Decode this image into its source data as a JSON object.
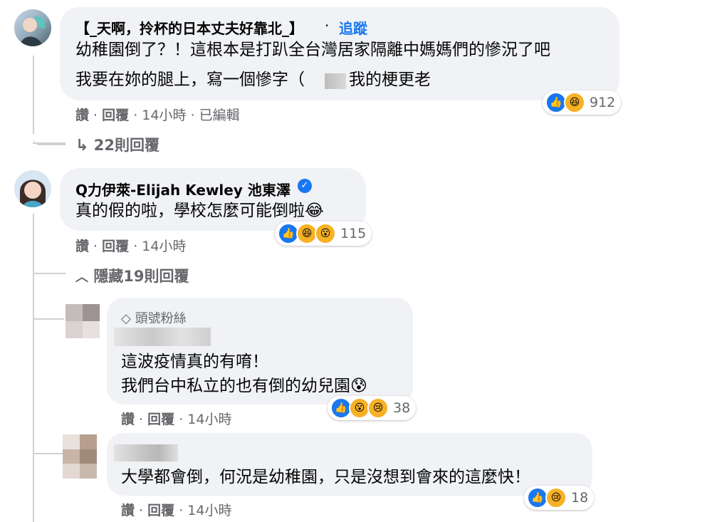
{
  "comments": [
    {
      "author": "【_天啊，拎杯的日本丈夫好靠北_】",
      "follow_label": "追蹤",
      "lines": [
        "幼稚園倒了？！這根本是打趴全台灣居家隔離中媽媽們的慘況了吧",
        "我要在妳的腿上，寫一個慘字（",
        "我的梗更老"
      ],
      "meta": {
        "like": "讚",
        "reply": "回覆",
        "time": "14小時",
        "edited": "已編輯"
      },
      "reactions": {
        "count": "912",
        "icons": [
          "like-icon",
          "haha-icon"
        ]
      },
      "replies_toggle": "22則回覆"
    },
    {
      "author": "Q力伊萊-Elijah Kewley 池東澤",
      "verified": true,
      "lines": [
        "真的假的啦，學校怎麼可能倒啦😂"
      ],
      "meta": {
        "like": "讚",
        "reply": "回覆",
        "time": "14小時"
      },
      "reactions": {
        "count": "115",
        "icons": [
          "like-icon",
          "haha-icon",
          "wow-icon"
        ]
      },
      "replies_toggle": "隱藏19則回覆"
    }
  ],
  "replies": [
    {
      "badge": "頭號粉絲",
      "lines": [
        "這波疫情真的有唷！",
        "我們台中私立的也有倒的幼兒園😰"
      ],
      "meta": {
        "like": "讚",
        "reply": "回覆",
        "time": "14小時"
      },
      "reactions": {
        "count": "38",
        "icons": [
          "like-icon",
          "wow-icon",
          "sad-icon"
        ]
      }
    },
    {
      "lines": [
        "大學都會倒，何況是幼稚園，只是沒想到會來的這麼快！"
      ],
      "meta": {
        "like": "讚",
        "reply": "回覆",
        "time": "14小時"
      },
      "reactions": {
        "count": "18",
        "icons": [
          "like-icon",
          "sad-icon"
        ]
      }
    }
  ],
  "colors": {
    "like": "#1877f2",
    "bubble": "#f0f2f5",
    "meta": "#65676b",
    "follow": "#1877f2"
  }
}
